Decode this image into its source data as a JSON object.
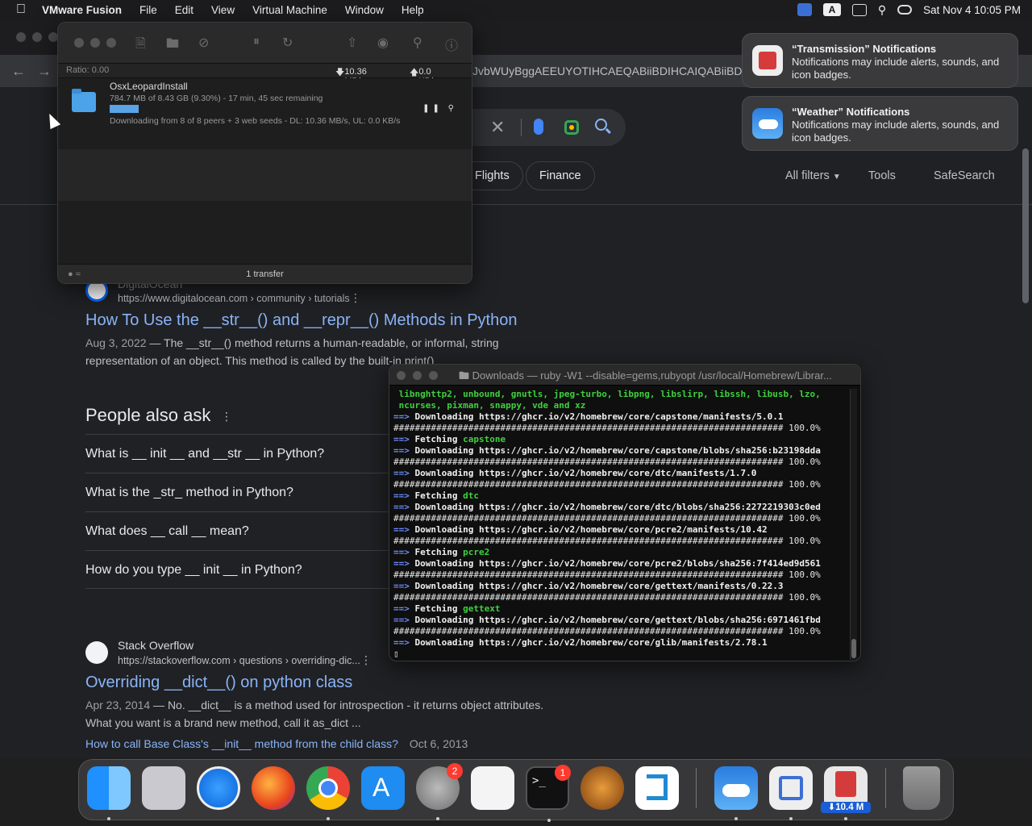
{
  "menubar": {
    "apple": "",
    "items": [
      "VMware Fusion",
      "File",
      "Edit",
      "View",
      "Virtual Machine",
      "Window",
      "Help"
    ],
    "input_indicator": "A",
    "clock": "Sat Nov 4  10:05 PM"
  },
  "browser": {
    "url_fragment": "JvbWUyBggAEEUYOTIHCAEQABiiBDIHCAIQABiiBD",
    "chips": [
      "Flights",
      "Finance"
    ],
    "filters": [
      "All filters",
      "Tools",
      "SafeSearch"
    ],
    "results": [
      {
        "source": "DigitalOcean",
        "url": "https://www.digitalocean.com › community › tutorials",
        "title": "How To Use the __str__() and __repr__() Methods in Python",
        "date": "Aug 3, 2022",
        "snippet": " — The __str__() method returns a human-readable, or informal, string representation of an object. This method is called by the built-in print()"
      },
      {
        "source": "Stack Overflow",
        "url": "https://stackoverflow.com › questions › overriding-dic...",
        "title": "Overriding __dict__() on python class",
        "date": "Apr 23, 2014",
        "snippet": " — No. __dict__ is a method used for introspection - it returns object attributes. What you want is a brand new method, call it as_dict ...",
        "sublink": "How to call Base Class's __init__ method from the child class?",
        "sublink_date": "Oct 6, 2013"
      }
    ],
    "people_also_ask": {
      "title": "People also ask",
      "questions": [
        "What is __ init __ and __str __ in Python?",
        "What is the _str_ method in Python?",
        "What does __ call __ mean?",
        "How do you type __ init __ in Python?"
      ]
    }
  },
  "transmission": {
    "ratio": "Ratio: 0.00",
    "down_speed": "10.36 MB/s",
    "up_speed": "0.0 KB/s",
    "torrent": {
      "name": "OsxLeopardInstall",
      "progress_text": "784.7 MB of 8.43 GB (9.30%) - 17 min, 45 sec remaining",
      "progress": 0.093,
      "status": "Downloading from 8 of 8 peers + 3 web seeds - DL: 10.36 MB/s, UL: 0.0 KB/s"
    },
    "footer": "1 transfer"
  },
  "notifications": [
    {
      "title": "“Transmission” Notifications",
      "body": "Notifications may include alerts, sounds, and icon badges."
    },
    {
      "title": "“Weather” Notifications",
      "body": "Notifications may include alerts, sounds, and icon badges."
    }
  ],
  "terminal": {
    "title": "Downloads — ruby -W1 --disable=gems,rubyopt /usr/local/Homebrew/Librar...",
    "lines": [
      {
        "t": "green",
        "text": " libnghttp2, unbound, gnutls, jpeg-turbo, libpng, libslirp, libssh, libusb, lzo,"
      },
      {
        "t": "green",
        "text": " ncurses, pixman, snappy, vde and xz"
      },
      {
        "t": "arrow",
        "text": "Downloading https://ghcr.io/v2/homebrew/core/capstone/manifests/5.0.1"
      },
      {
        "t": "hash",
        "text": "######################################################################### 100.0%"
      },
      {
        "t": "fetch",
        "text": "capstone"
      },
      {
        "t": "arrow",
        "text": "Downloading https://ghcr.io/v2/homebrew/core/capstone/blobs/sha256:b23198dda"
      },
      {
        "t": "hash",
        "text": "######################################################################### 100.0%"
      },
      {
        "t": "arrow",
        "text": "Downloading https://ghcr.io/v2/homebrew/core/dtc/manifests/1.7.0"
      },
      {
        "t": "hash",
        "text": "######################################################################### 100.0%"
      },
      {
        "t": "fetch",
        "text": "dtc"
      },
      {
        "t": "arrow",
        "text": "Downloading https://ghcr.io/v2/homebrew/core/dtc/blobs/sha256:2272219303c0ed"
      },
      {
        "t": "hash",
        "text": "######################################################################### 100.0%"
      },
      {
        "t": "arrow",
        "text": "Downloading https://ghcr.io/v2/homebrew/core/pcre2/manifests/10.42"
      },
      {
        "t": "hash",
        "text": "######################################################################### 100.0%"
      },
      {
        "t": "fetch",
        "text": "pcre2"
      },
      {
        "t": "arrow",
        "text": "Downloading https://ghcr.io/v2/homebrew/core/pcre2/blobs/sha256:7f414ed9d561"
      },
      {
        "t": "hash",
        "text": "######################################################################### 100.0%"
      },
      {
        "t": "arrow",
        "text": "Downloading https://ghcr.io/v2/homebrew/core/gettext/manifests/0.22.3"
      },
      {
        "t": "hash",
        "text": "######################################################################### 100.0%"
      },
      {
        "t": "fetch",
        "text": "gettext"
      },
      {
        "t": "arrow",
        "text": "Downloading https://ghcr.io/v2/homebrew/core/gettext/blobs/sha256:6971461fbd"
      },
      {
        "t": "hash",
        "text": "######################################################################### 100.0%"
      },
      {
        "t": "arrow",
        "text": "Downloading https://ghcr.io/v2/homebrew/core/glib/manifests/2.78.1"
      },
      {
        "t": "cursor",
        "text": "▯"
      }
    ]
  },
  "dock": {
    "apps": [
      "Finder",
      "Launchpad",
      "Safari",
      "Firefox",
      "Chrome",
      "App Store",
      "System Settings",
      "TextEdit",
      "Terminal",
      "GarageBand",
      "VS Code",
      "Weather",
      "VMware Fusion",
      "Transmission"
    ],
    "settings_badge": "2",
    "terminal_badge": "1",
    "transmission_speed": "⬇10.4 M"
  },
  "colors": {
    "link": "#8ab4f8",
    "terminal_green": "#3ed13e",
    "terminal_blue": "#6b8cff",
    "progress": "#5aa3e6"
  }
}
